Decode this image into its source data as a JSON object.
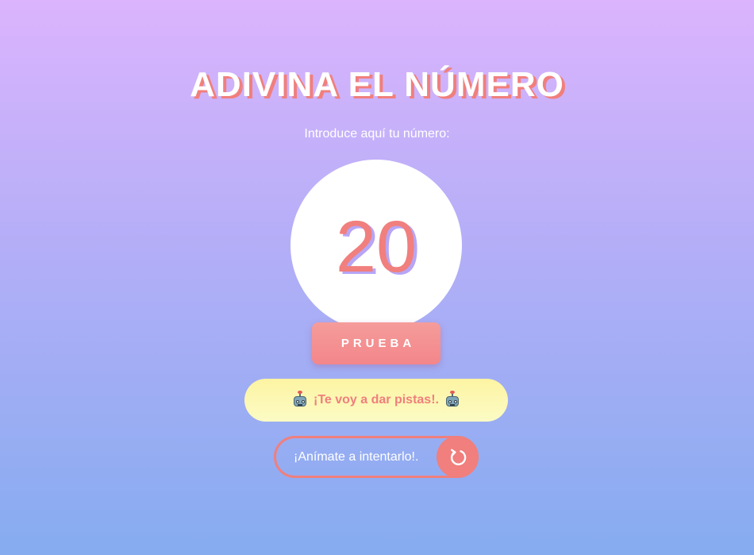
{
  "header": {
    "title": "ADIVINA EL NÚMERO",
    "prompt": "Introduce aquí tu número:"
  },
  "guess": {
    "value": "20"
  },
  "actions": {
    "try_label": "PRUEBA"
  },
  "hint": {
    "text": "¡Te voy a dar pistas!.",
    "icon": "robot-icon"
  },
  "status": {
    "text": "¡Anímate a intentarlo!.",
    "reset_icon": "refresh-icon"
  },
  "colors": {
    "accent": "#f07f7d",
    "hint_bg": "#fdf4a3",
    "shadow_purple": "#b7a5f5"
  }
}
